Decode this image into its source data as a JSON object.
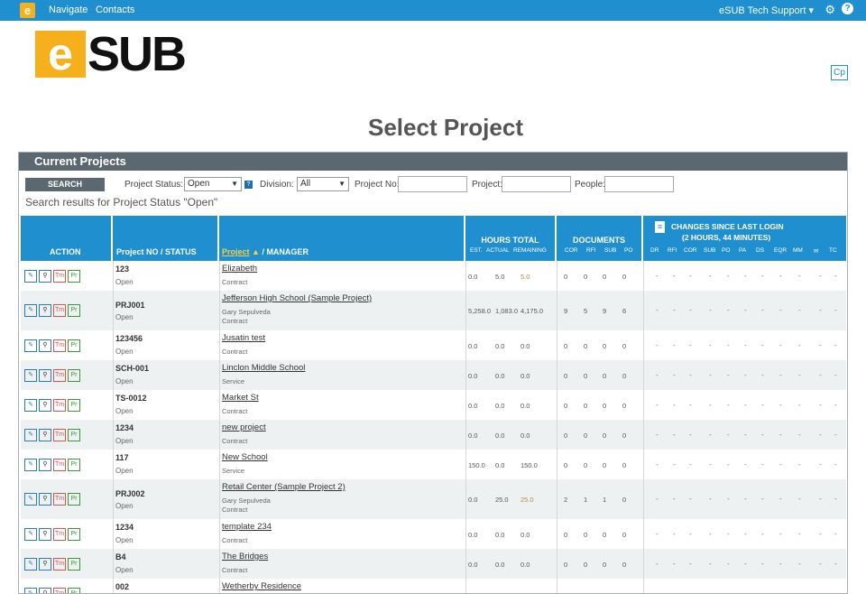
{
  "topbar": {
    "logo_letter": "e",
    "nav": [
      "Navigate",
      "Contacts"
    ],
    "user": "eSUB Tech Support",
    "help": "?"
  },
  "brand": {
    "e": "e",
    "sub": "SUB"
  },
  "cp_label": "Cp",
  "page_title": "Select Project",
  "panel_title": "Current Projects",
  "filters": {
    "search_label": "SEARCH",
    "status_label": "Project Status:",
    "status_value": "Open",
    "division_label": "Division:",
    "division_value": "All",
    "project_no_label": "Project No:",
    "project_label": "Project:",
    "people_label": "People:"
  },
  "results_text": "Search results for Project Status \"Open\"",
  "headers": {
    "action": "ACTION",
    "project_no_status": "Project NO / STATUS",
    "project": "Project",
    "manager": " /  MANAGER",
    "hours_total": "HOURS TOTAL",
    "hours_sub": [
      "EST.",
      "ACTUAL",
      "REMAINING"
    ],
    "documents": "DOCUMENTS",
    "doc_sub": [
      "COR",
      "RFI",
      "SUB",
      "PO"
    ],
    "changes_line1": "CHANGES SINCE LAST LOGIN",
    "changes_line2": "(2 HOURS, 44 MINUTES)",
    "change_sub": [
      "DR",
      "RFI",
      "COR",
      "SUB",
      "PO",
      "PA",
      "DS",
      "EQR",
      "MM",
      "✉",
      "TC"
    ]
  },
  "action_icons": {
    "tm": "Tm",
    "pr": "Pr"
  },
  "rows": [
    {
      "no": "123",
      "status": "Open",
      "name": "Elizabeth",
      "manager": "",
      "type": "Contract",
      "est": "0.0",
      "actual": "5.0",
      "remaining": "5.0",
      "cor": "0",
      "rfi": "0",
      "sub": "0",
      "po": "0",
      "remaining_hl": true
    },
    {
      "no": "PRJ001",
      "status": "Open",
      "name": "Jefferson High School (Sample Project)",
      "manager": "Gary Sepulveda",
      "type": "Contract",
      "est": "5,258.0",
      "actual": "1,083.0",
      "remaining": "4,175.0",
      "cor": "9",
      "rfi": "5",
      "sub": "9",
      "po": "6"
    },
    {
      "no": "123456",
      "status": "Open",
      "name": "Jusatin test",
      "manager": "",
      "type": "Contract",
      "est": "0.0",
      "actual": "0.0",
      "remaining": "0.0",
      "cor": "0",
      "rfi": "0",
      "sub": "0",
      "po": "0"
    },
    {
      "no": "SCH-001",
      "status": "Open",
      "name": "Linclon Middle School",
      "manager": "",
      "type": "Service",
      "est": "0.0",
      "actual": "0.0",
      "remaining": "0.0",
      "cor": "0",
      "rfi": "0",
      "sub": "0",
      "po": "0"
    },
    {
      "no": "TS-0012",
      "status": "Open",
      "name": "Market St",
      "manager": "",
      "type": "Contract",
      "est": "0.0",
      "actual": "0.0",
      "remaining": "0.0",
      "cor": "0",
      "rfi": "0",
      "sub": "0",
      "po": "0"
    },
    {
      "no": "1234",
      "status": "Open",
      "name": "new project",
      "manager": "",
      "type": "Contract",
      "est": "0.0",
      "actual": "0.0",
      "remaining": "0.0",
      "cor": "0",
      "rfi": "0",
      "sub": "0",
      "po": "0"
    },
    {
      "no": "117",
      "status": "Open",
      "name": "New School",
      "manager": "",
      "type": "Service",
      "est": "150.0",
      "actual": "0.0",
      "remaining": "150.0",
      "cor": "0",
      "rfi": "0",
      "sub": "0",
      "po": "0"
    },
    {
      "no": "PRJ002",
      "status": "Open",
      "name": "Retail Center (Sample Project 2)",
      "manager": "Gary Sepulveda",
      "type": "Contract",
      "est": "0.0",
      "actual": "25.0",
      "remaining": "25.0",
      "cor": "2",
      "rfi": "1",
      "sub": "1",
      "po": "0",
      "remaining_hl": true
    },
    {
      "no": "1234",
      "status": "Open",
      "name": "template 234",
      "manager": "",
      "type": "Contract",
      "est": "0.0",
      "actual": "0.0",
      "remaining": "0.0",
      "cor": "0",
      "rfi": "0",
      "sub": "0",
      "po": "0"
    },
    {
      "no": "B4",
      "status": "Open",
      "name": "The Bridges",
      "manager": "",
      "type": "Contract",
      "est": "0.0",
      "actual": "0.0",
      "remaining": "0.0",
      "cor": "0",
      "rfi": "0",
      "sub": "0",
      "po": "0"
    },
    {
      "no": "002",
      "status": "",
      "name": "Wetherby Residence",
      "manager": "",
      "type": "",
      "est": "",
      "actual": "",
      "remaining": "",
      "cor": "",
      "rfi": "",
      "sub": "",
      "po": ""
    }
  ]
}
